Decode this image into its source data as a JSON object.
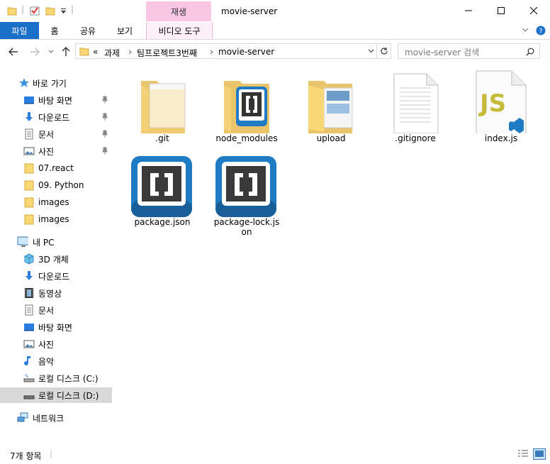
{
  "window": {
    "title": "movie-server",
    "context_tab": "재생"
  },
  "ribbon": {
    "tabs": [
      "파일",
      "홈",
      "공유",
      "보기",
      "비디오 도구"
    ]
  },
  "address": {
    "overflow": "«",
    "crumbs": [
      "과제",
      "팀프로젝트3번째",
      "movie-server"
    ],
    "search_placeholder": "movie-server 검색"
  },
  "nav": {
    "quick_access": "바로 가기",
    "quick_items": [
      "바탕 화면",
      "다운로드",
      "문서",
      "사진",
      "07.react",
      "09. Python",
      "images",
      "images"
    ],
    "this_pc": "내 PC",
    "pc_items": [
      "3D 개체",
      "다운로드",
      "동영상",
      "문서",
      "바탕 화면",
      "사진",
      "음악",
      "로컬 디스크 (C:)",
      "로컬 디스크 (D:)"
    ],
    "network": "네트워크"
  },
  "files": [
    {
      "name": ".git",
      "kind": "folder-icon"
    },
    {
      "name": "node_modules",
      "kind": "brackets-folder-icon"
    },
    {
      "name": "upload",
      "kind": "folder-icon"
    },
    {
      "name": ".gitignore",
      "kind": "text-file-icon"
    },
    {
      "name": "index.js",
      "kind": "js-file-icon",
      "badge": "JS"
    },
    {
      "name": "package.json",
      "kind": "brackets-icon"
    },
    {
      "name": "package-lock.json",
      "kind": "brackets-icon"
    }
  ],
  "status": {
    "count": "7개 항목"
  },
  "colors": {
    "accent": "#1a6fc9",
    "context_tab": "#f9c6e3",
    "folder": "#f8d775",
    "js": "#c5bb3a"
  }
}
